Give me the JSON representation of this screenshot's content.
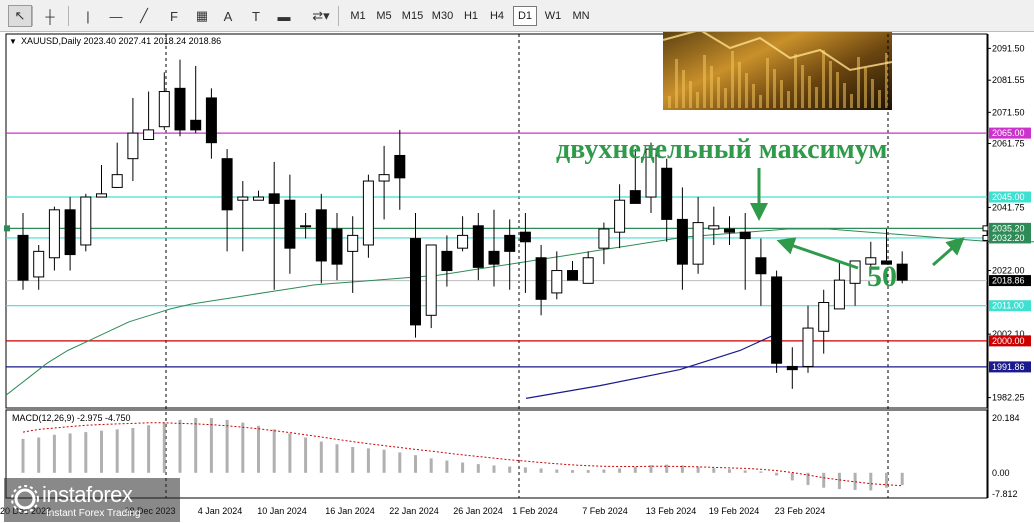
{
  "toolbar": {
    "tools": [
      {
        "name": "cursor-icon",
        "glyph": "↖",
        "pressed": true
      },
      {
        "name": "crosshair-icon",
        "glyph": "┼",
        "pressed": false
      },
      {
        "name": "vertical-line-icon",
        "glyph": "|",
        "pressed": false
      },
      {
        "name": "horizontal-line-icon",
        "glyph": "—",
        "pressed": false
      },
      {
        "name": "trendline-icon",
        "glyph": "╱",
        "pressed": false
      },
      {
        "name": "fibonacci-icon",
        "glyph": "F",
        "pressed": false
      },
      {
        "name": "grid-icon",
        "glyph": "▦",
        "pressed": false
      },
      {
        "name": "text-icon",
        "glyph": "A",
        "pressed": false
      },
      {
        "name": "text-label-icon",
        "glyph": "T",
        "pressed": false
      },
      {
        "name": "rectangle-icon",
        "glyph": "▬",
        "pressed": false
      },
      {
        "name": "arrows-icon",
        "glyph": "⇄▾",
        "pressed": false
      }
    ],
    "timeframes": [
      "M1",
      "M5",
      "M15",
      "M30",
      "H1",
      "H4",
      "D1",
      "W1",
      "MN"
    ],
    "active_timeframe": "D1"
  },
  "chart_header": "XAUUSD,Daily  2023.40 2027.41 2018.24 2018.86",
  "annotation_text": "двухнедельный максимум",
  "annotation_number": "50",
  "macd_header": "MACD(12,26,9) -2.975 -4.750",
  "watermark": {
    "brand": "instaforex",
    "tagline": "Instant Forex Trading"
  },
  "colors": {
    "bull_candle": "#ffffff",
    "bear_candle": "#000000",
    "ma_line": "#2e8b57",
    "ma_blue": "#1a1a8c",
    "resistance_magenta": "#cc33cc",
    "level_cyan": "#40e0d0",
    "level_green": "#2e8b57",
    "level_red": "#cc0000",
    "level_navy": "#1a1a8c",
    "annotation_green": "#2e9a4a",
    "macd_signal": "#cc0000",
    "macd_hist": "#b0b0b0"
  },
  "chart_data": {
    "type": "candlestick",
    "symbol": "XAUUSD",
    "timeframe": "Daily",
    "ohlc_last": {
      "open": 2023.4,
      "high": 2027.41,
      "low": 2018.24,
      "close": 2018.86
    },
    "ylim": [
      1979,
      2096
    ],
    "y_ticks": [
      2091.5,
      2081.55,
      2071.5,
      2061.75,
      2041.75,
      2022.0,
      2002.1,
      1982.25
    ],
    "price_labels": [
      {
        "value": 2065.0,
        "text": "2065.00",
        "color": "#cc33cc"
      },
      {
        "value": 2045.0,
        "text": "2045.00",
        "color": "#40e0d0"
      },
      {
        "value": 2035.2,
        "text": "2035.20",
        "color": "#2e8b57"
      },
      {
        "value": 2032.2,
        "text": "2032.20",
        "color": "#2e8b57"
      },
      {
        "value": 2018.86,
        "text": "2018.86",
        "color": "#000000"
      },
      {
        "value": 2011.0,
        "text": "2011.00",
        "color": "#40e0d0"
      },
      {
        "value": 2000.0,
        "text": "2000.00",
        "color": "#cc0000"
      },
      {
        "value": 1991.86,
        "text": "1991.86",
        "color": "#1a1a8c"
      }
    ],
    "horizontal_lines": [
      {
        "value": 2065.0,
        "color": "#cc33cc"
      },
      {
        "value": 2045.0,
        "color": "#40e0d0"
      },
      {
        "value": 2035.2,
        "color": "#2e8b57"
      },
      {
        "value": 2032.2,
        "color": "#40e0d0"
      },
      {
        "value": 2011.0,
        "color": "#40e0d0"
      },
      {
        "value": 2000.0,
        "color": "#cc0000"
      },
      {
        "value": 1991.86,
        "color": "#1a1a8c"
      }
    ],
    "x_labels": [
      "20 Dec 2023",
      "28 Dec 2023",
      "4 Jan 2024",
      "10 Jan 2024",
      "16 Jan 2024",
      "22 Jan 2024",
      "26 Jan 2024",
      "1 Feb 2024",
      "7 Feb 2024",
      "13 Feb 2024",
      "19 Feb 2024",
      "23 Feb 2024"
    ],
    "candles": [
      [
        2033,
        2040,
        2016,
        2019
      ],
      [
        2020,
        2030,
        2016,
        2028
      ],
      [
        2026,
        2042,
        2022,
        2041
      ],
      [
        2041,
        2045,
        2022,
        2027
      ],
      [
        2030,
        2046,
        2028,
        2045
      ],
      [
        2045,
        2055,
        2046,
        2046
      ],
      [
        2048,
        2062,
        2048,
        2052
      ],
      [
        2057,
        2076,
        2050,
        2065
      ],
      [
        2063,
        2078,
        2063,
        2066
      ],
      [
        2067,
        2084,
        2066,
        2078
      ],
      [
        2079,
        2088,
        2064,
        2066
      ],
      [
        2069,
        2086,
        2065,
        2066
      ],
      [
        2076,
        2079,
        2057,
        2062
      ],
      [
        2057,
        2060,
        2028,
        2041
      ],
      [
        2044,
        2050,
        2028,
        2045
      ],
      [
        2044,
        2047,
        2044,
        2045
      ],
      [
        2046,
        2056,
        2016,
        2043
      ],
      [
        2044,
        2052,
        2021,
        2029
      ],
      [
        2036,
        2040,
        2032,
        2036
      ],
      [
        2041,
        2046,
        2018,
        2025
      ],
      [
        2035,
        2040,
        2019,
        2024
      ],
      [
        2028,
        2039,
        2015,
        2033
      ],
      [
        2030,
        2052,
        2026,
        2050
      ],
      [
        2050,
        2061,
        2038,
        2052
      ],
      [
        2058,
        2066,
        2041,
        2051
      ],
      [
        2032,
        2040,
        2001,
        2005
      ],
      [
        2008,
        2029,
        2004,
        2030
      ],
      [
        2028,
        2033,
        2017,
        2022
      ],
      [
        2029,
        2039,
        2028,
        2033
      ],
      [
        2036,
        2040,
        2019,
        2023
      ],
      [
        2028,
        2041,
        2017,
        2024
      ],
      [
        2033,
        2038,
        2016,
        2028
      ],
      [
        2034,
        2040,
        2015,
        2031
      ],
      [
        2026,
        2030,
        2008,
        2013
      ],
      [
        2015,
        2028,
        2013,
        2022
      ],
      [
        2022,
        2025,
        2019,
        2019
      ],
      [
        2018,
        2028,
        2018,
        2026
      ],
      [
        2029,
        2037,
        2024,
        2035
      ],
      [
        2034,
        2049,
        2029,
        2044
      ],
      [
        2047,
        2060,
        2043,
        2043
      ],
      [
        2045,
        2062,
        2040,
        2060
      ],
      [
        2054,
        2057,
        2031,
        2038
      ],
      [
        2038,
        2048,
        2016,
        2024
      ],
      [
        2024,
        2045,
        2021,
        2037
      ],
      [
        2035,
        2042,
        2030,
        2036
      ],
      [
        2035,
        2039,
        2030,
        2034
      ],
      [
        2034,
        2040,
        2016,
        2032
      ],
      [
        2026,
        2032,
        2011,
        2021
      ],
      [
        2020,
        2022,
        1990,
        1993
      ],
      [
        1992,
        1998,
        1985,
        1991
      ],
      [
        1992,
        2011,
        1990,
        2004
      ],
      [
        2003,
        2016,
        1996,
        2012
      ],
      [
        2010,
        2025,
        2010,
        2019
      ],
      [
        2018,
        2025,
        2011,
        2025
      ],
      [
        2024,
        2031,
        2021,
        2026
      ],
      [
        2025,
        2035,
        2024,
        2024
      ],
      [
        2024,
        2028,
        2018,
        2019
      ]
    ],
    "macd": {
      "title": "MACD(12,26,9) -2.975 -4.750",
      "y_ticks": [
        "20.184",
        "0.00",
        "-7.812"
      ],
      "histogram": [
        12.5,
        13,
        14,
        14.5,
        15,
        15.5,
        16,
        16.5,
        17.5,
        18.5,
        19.5,
        20.2,
        20.2,
        19.5,
        18.5,
        17.3,
        16,
        14.5,
        13,
        11.5,
        10.5,
        9.5,
        9,
        8.5,
        7.5,
        6.5,
        5.3,
        4.5,
        3.8,
        3.2,
        2.7,
        2.3,
        2,
        1.6,
        1.2,
        1,
        1,
        1.2,
        1.6,
        2.2,
        2.8,
        3,
        2.7,
        2.2,
        1.7,
        1.3,
        0.9,
        0.5,
        -1,
        -2.8,
        -4.5,
        -5.5,
        -6,
        -6.3,
        -6.5,
        -5.5,
        -4.5
      ],
      "signal": [
        15,
        16,
        16.5,
        17,
        17.5,
        17.8,
        18,
        18.2,
        18.4,
        18.4,
        18.2,
        18,
        17.7,
        17.3,
        16.8,
        16.2,
        15.5,
        14.8,
        14,
        13.2,
        12.3,
        11.5,
        10.7,
        10,
        9.3,
        8.6,
        8,
        7.3,
        6.6,
        6,
        5.4,
        4.8,
        4.3,
        3.8,
        3.3,
        2.9,
        2.6,
        2.4,
        2.3,
        2.3,
        2.4,
        2.4,
        2.3,
        2.2,
        2,
        1.8,
        1.6,
        1.3,
        0.8,
        0.1,
        -0.8,
        -1.8,
        -2.6,
        -3.3,
        -4,
        -4.4,
        -4.75
      ]
    }
  }
}
